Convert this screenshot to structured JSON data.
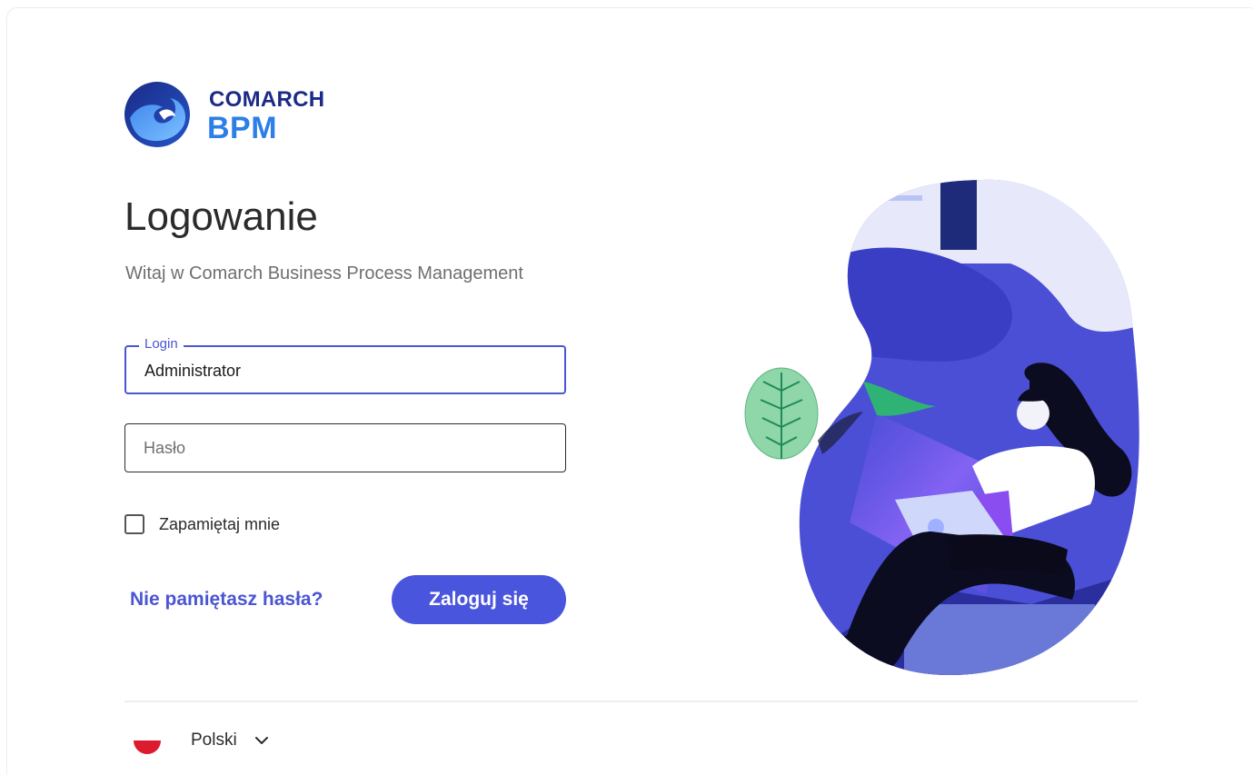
{
  "brand": {
    "line1": "COMARCH",
    "line2": "BPM",
    "colors": {
      "dark": "#1b2a86",
      "light": "#2d7ee8",
      "accent": "#4a55dd"
    }
  },
  "heading": {
    "title": "Logowanie",
    "subtitle": "Witaj w Comarch Business Process Management"
  },
  "form": {
    "login": {
      "label": "Login",
      "value": "Administrator"
    },
    "password": {
      "placeholder": "Hasło",
      "value": ""
    },
    "remember_label": "Zapamiętaj mnie",
    "remember_checked": false,
    "forgot_link": "Nie pamiętasz hasła?",
    "submit_label": "Zaloguj się"
  },
  "footer": {
    "language_label": "Polski",
    "flag_icon": "flag-poland-icon",
    "dropdown_icon": "chevron-down-icon"
  }
}
